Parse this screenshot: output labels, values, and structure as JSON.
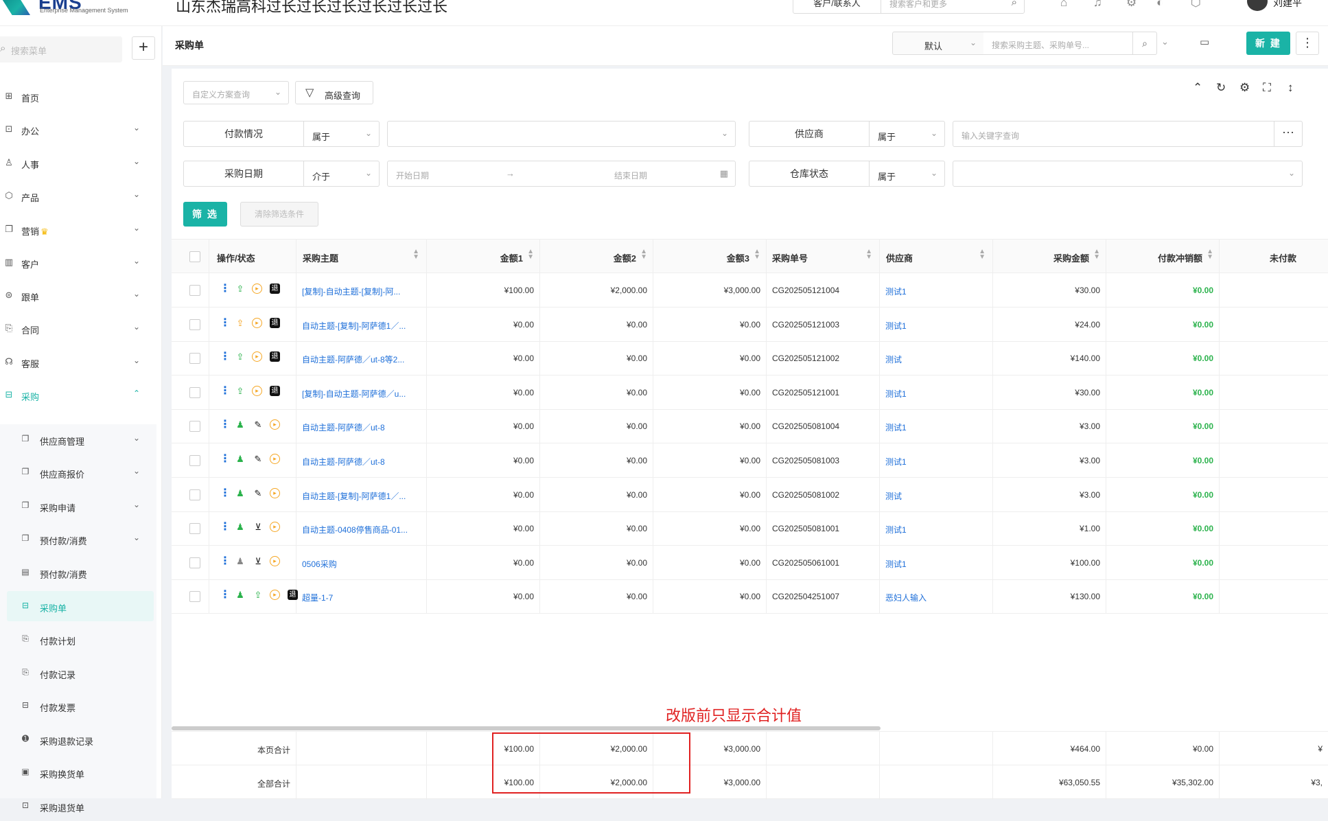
{
  "app": {
    "logo_text": "EMS",
    "logo_sub": "Enterprise Management System",
    "company_name": "山东杰瑞高科过长过长过长过长过长过长",
    "search_scope": "客户/联系人",
    "search_placeholder": "搜索客户和更多",
    "user_name": "刘建平"
  },
  "sidebar": {
    "search_placeholder": "搜索菜单",
    "items": [
      {
        "label": "首页",
        "icon": "home-icon"
      },
      {
        "label": "办公",
        "icon": "office-icon"
      },
      {
        "label": "人事",
        "icon": "people-icon"
      },
      {
        "label": "产品",
        "icon": "box-icon"
      },
      {
        "label": "营销",
        "icon": "marketing-icon"
      },
      {
        "label": "客户",
        "icon": "chart-icon"
      },
      {
        "label": "跟单",
        "icon": "follow-icon"
      },
      {
        "label": "合同",
        "icon": "contract-icon"
      },
      {
        "label": "客服",
        "icon": "service-icon"
      },
      {
        "label": "采购",
        "icon": "purchase-icon"
      }
    ],
    "sub_items": [
      {
        "label": "供应商管理"
      },
      {
        "label": "供应商报价"
      },
      {
        "label": "采购申请"
      },
      {
        "label": "预付款/消费"
      },
      {
        "label": "预付款/消费"
      },
      {
        "label": "采购单"
      },
      {
        "label": "付款计划"
      },
      {
        "label": "付款记录"
      },
      {
        "label": "付款发票"
      },
      {
        "label": "采购退款记录"
      },
      {
        "label": "采购换货单"
      },
      {
        "label": "采购退货单"
      }
    ]
  },
  "header": {
    "title": "采购单",
    "view": "默认",
    "search_placeholder": "搜索采购主题、采购单号...",
    "new_label": "新 建"
  },
  "filters": {
    "scheme_placeholder": "自定义方案查询",
    "advanced_label": "高级查询",
    "payment_label": "付款情况",
    "payment_op": "属于",
    "supplier_label": "供应商",
    "supplier_op": "属于",
    "supplier_placeholder": "输入关键字查询",
    "date_label": "采购日期",
    "date_op": "介于",
    "date_start": "开始日期",
    "date_end": "结束日期",
    "warehouse_label": "仓库状态",
    "warehouse_op": "属于",
    "filter_btn": "筛 选",
    "clear_btn": "清除筛选条件"
  },
  "table": {
    "columns": [
      "操作/状态",
      "采购主题",
      "金额1",
      "金额2",
      "金额3",
      "采购单号",
      "供应商",
      "采购金额",
      "付款冲销额",
      "未付款"
    ],
    "rows": [
      {
        "subject": "[复制]-自动主题-[复制]-阿...",
        "amt1": "¥100.00",
        "amt2": "¥2,000.00",
        "amt3": "¥3,000.00",
        "no": "CG202505121004",
        "supplier": "测试1",
        "total": "¥30.00",
        "offset": "¥0.00"
      },
      {
        "subject": "自动主题-[复制]-阿萨德1／...",
        "amt1": "¥0.00",
        "amt2": "¥0.00",
        "amt3": "¥0.00",
        "no": "CG202505121003",
        "supplier": "测试1",
        "total": "¥24.00",
        "offset": "¥0.00"
      },
      {
        "subject": "自动主题-阿萨德／ut-8等2...",
        "amt1": "¥0.00",
        "amt2": "¥0.00",
        "amt3": "¥0.00",
        "no": "CG202505121002",
        "supplier": "测试",
        "total": "¥140.00",
        "offset": "¥0.00"
      },
      {
        "subject": "[复制]-自动主题-阿萨德／u...",
        "amt1": "¥0.00",
        "amt2": "¥0.00",
        "amt3": "¥0.00",
        "no": "CG202505121001",
        "supplier": "测试1",
        "total": "¥30.00",
        "offset": "¥0.00"
      },
      {
        "subject": "自动主题-阿萨德／ut-8",
        "amt1": "¥0.00",
        "amt2": "¥0.00",
        "amt3": "¥0.00",
        "no": "CG202505081004",
        "supplier": "测试1",
        "total": "¥3.00",
        "offset": "¥0.00"
      },
      {
        "subject": "自动主题-阿萨德／ut-8",
        "amt1": "¥0.00",
        "amt2": "¥0.00",
        "amt3": "¥0.00",
        "no": "CG202505081003",
        "supplier": "测试1",
        "total": "¥3.00",
        "offset": "¥0.00"
      },
      {
        "subject": "自动主题-[复制]-阿萨德1／...",
        "amt1": "¥0.00",
        "amt2": "¥0.00",
        "amt3": "¥0.00",
        "no": "CG202505081002",
        "supplier": "测试",
        "total": "¥3.00",
        "offset": "¥0.00"
      },
      {
        "subject": "自动主题-0408停售商品-01...",
        "amt1": "¥0.00",
        "amt2": "¥0.00",
        "amt3": "¥0.00",
        "no": "CG202505081001",
        "supplier": "测试1",
        "total": "¥1.00",
        "offset": "¥0.00"
      },
      {
        "subject": "0506采购",
        "amt1": "¥0.00",
        "amt2": "¥0.00",
        "amt3": "¥0.00",
        "no": "CG202505061001",
        "supplier": "测试1",
        "total": "¥100.00",
        "offset": "¥0.00"
      },
      {
        "subject": "超量-1-7",
        "amt1": "¥0.00",
        "amt2": "¥0.00",
        "amt3": "¥0.00",
        "no": "CG202504251007",
        "supplier": "恶妇人输入",
        "total": "¥130.00",
        "offset": "¥0.00"
      }
    ],
    "footer": [
      {
        "label": "本页合计",
        "amt1": "¥100.00",
        "amt2": "¥2,000.00",
        "amt3": "¥3,000.00",
        "total": "¥464.00",
        "offset": "¥0.00",
        "unpaid": "¥"
      },
      {
        "label": "全部合计",
        "amt1": "¥100.00",
        "amt2": "¥2,000.00",
        "amt3": "¥3,000.00",
        "total": "¥63,050.55",
        "offset": "¥35,302.00",
        "unpaid": "¥3,"
      }
    ]
  },
  "annotation": "改版前只显示合计值",
  "colors": {
    "accent": "#1ab3a6",
    "link": "#1e6fd9",
    "positive": "#2bb24c",
    "annotation": "#e02020"
  }
}
